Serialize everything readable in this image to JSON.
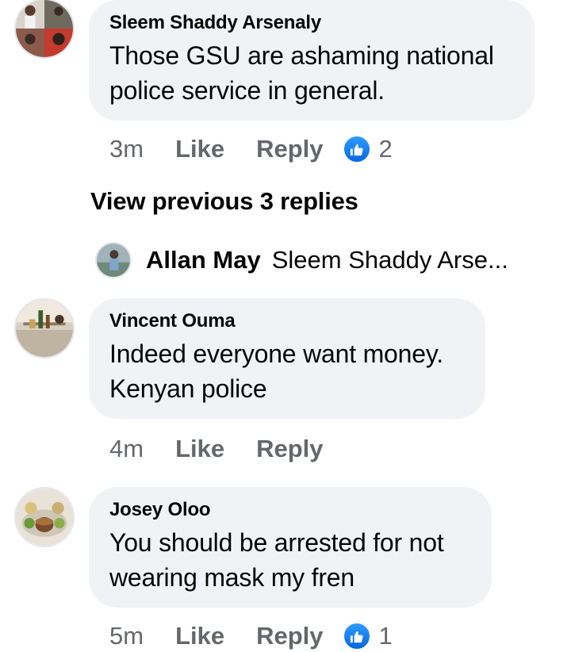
{
  "comments": [
    {
      "author": "Sleem Shaddy Arsenaly",
      "text_lines": [
        "Those GSU are ashaming national",
        "police service in general."
      ],
      "time": "3m",
      "like_label": "Like",
      "reply_label": "Reply",
      "reaction_count": "2"
    },
    {
      "author": "Vincent Ouma",
      "text_lines": [
        "Indeed everyone want money.",
        "Kenyan police"
      ],
      "time": "4m",
      "like_label": "Like",
      "reply_label": "Reply"
    },
    {
      "author": "Josey Oloo",
      "text_lines": [
        "You should be arrested for not",
        "wearing mask my fren"
      ],
      "time": "5m",
      "like_label": "Like",
      "reply_label": "Reply",
      "reaction_count": "1"
    }
  ],
  "view_previous_label": "View previous 3 replies",
  "reply_preview": {
    "author": "Allan May",
    "snippet": "Sleem Shaddy Arse..."
  },
  "colors": {
    "bubble_bg": "#f0f2f5",
    "secondary_text": "#65676b",
    "like_blue": "#1877f2"
  },
  "icons": {
    "reaction": "thumbs-up-icon"
  }
}
